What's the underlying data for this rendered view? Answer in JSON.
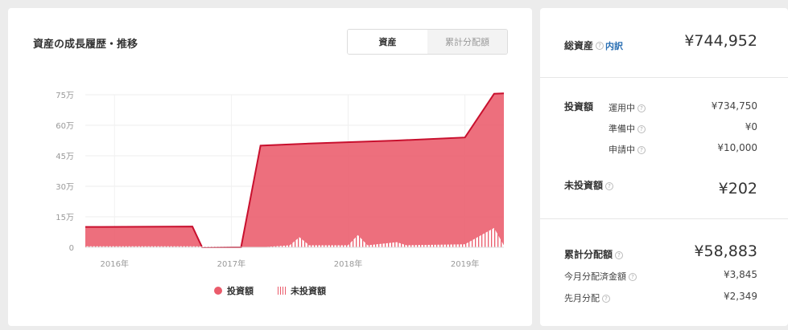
{
  "chart_panel": {
    "title": "資産の成長履歴・推移",
    "tabs": [
      {
        "label": "資産",
        "active": true
      },
      {
        "label": "累計分配額",
        "active": false
      }
    ],
    "legend": [
      "投資額",
      "未投資額"
    ]
  },
  "chart_data": {
    "type": "area",
    "title": "資産の成長履歴・推移",
    "y_unit": "万円",
    "ylim": [
      0,
      75
    ],
    "y_ticks": [
      "0",
      "15万",
      "30万",
      "45万",
      "60万",
      "75万"
    ],
    "y_tick_values": [
      0,
      15,
      30,
      45,
      60,
      75
    ],
    "x_tick_labels": [
      "2016年",
      "2017年",
      "2018年",
      "2019年"
    ],
    "x_tick_values": [
      "2016-01",
      "2017-01",
      "2018-01",
      "2019-01"
    ],
    "grid": true,
    "legend_position": "bottom",
    "series": [
      {
        "name": "投資額",
        "color": "#ea5b6b",
        "points": [
          [
            "2015-10",
            10
          ],
          [
            "2016-09",
            10.2
          ],
          [
            "2016-10",
            0
          ],
          [
            "2017-02",
            0
          ],
          [
            "2017-04",
            50
          ],
          [
            "2017-09",
            51
          ],
          [
            "2018-06",
            52.5
          ],
          [
            "2019-01",
            54
          ],
          [
            "2019-04",
            75.5
          ],
          [
            "2019-05",
            75.7
          ]
        ]
      },
      {
        "name": "未投資額",
        "color": "#ea5b6b",
        "points": [
          [
            "2015-10",
            0.5
          ],
          [
            "2016-09",
            0.5
          ],
          [
            "2017-04",
            0
          ],
          [
            "2017-07",
            1
          ],
          [
            "2017-08",
            5
          ],
          [
            "2017-09",
            1
          ],
          [
            "2018-01",
            1
          ],
          [
            "2018-02",
            6
          ],
          [
            "2018-03",
            1
          ],
          [
            "2018-06",
            2.5
          ],
          [
            "2018-07",
            1
          ],
          [
            "2019-01",
            1.5
          ],
          [
            "2019-04",
            9.5
          ],
          [
            "2019-05",
            1
          ]
        ]
      }
    ]
  },
  "summary": {
    "total_label": "総資産",
    "breakdown_link": "内訳",
    "total_value": "¥744,952",
    "invested_label": "投資額",
    "invested_rows": [
      {
        "label": "運用中",
        "value": "¥734,750"
      },
      {
        "label": "準備中",
        "value": "¥0"
      },
      {
        "label": "申請中",
        "value": "¥10,000"
      }
    ],
    "uninvested_label": "未投資額",
    "uninvested_value": "¥202",
    "dist_label": "累計分配額",
    "dist_value": "¥58,883",
    "dist_rows": [
      {
        "label": "今月分配済金額",
        "value": "¥3,845"
      },
      {
        "label": "先月分配",
        "value": "¥2,349"
      }
    ]
  }
}
